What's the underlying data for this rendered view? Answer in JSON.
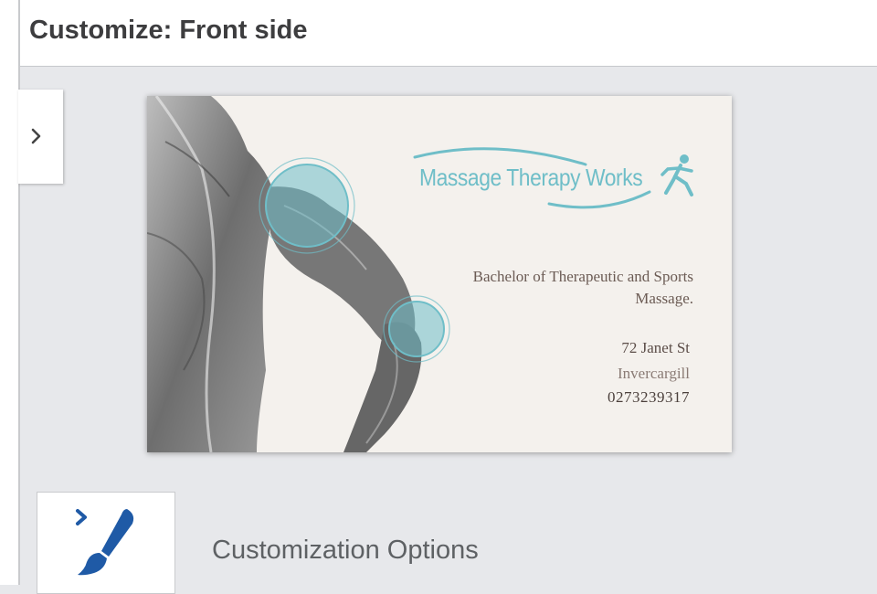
{
  "header": {
    "title": "Customize: Front side"
  },
  "sidebar": {
    "toggle_icon": "chevron-right-icon"
  },
  "card": {
    "brand": "Massage Therapy Works",
    "brand_icon": "running-figure-icon",
    "degree": "Bachelor of Therapeutic and Sports Massage.",
    "street": "72 Janet St",
    "city": "Invercargill",
    "phone": "0273239317",
    "accent_color": "#6fbec8"
  },
  "options": {
    "label": "Customization Options",
    "icon": "paintbrush-icon",
    "icon_color": "#1f5aa6"
  }
}
